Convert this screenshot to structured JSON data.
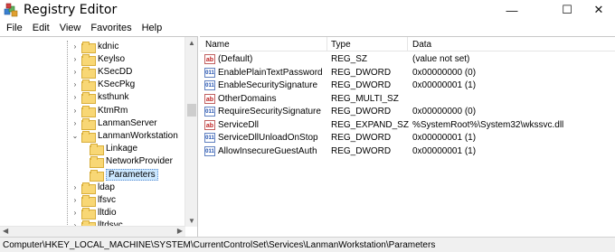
{
  "window": {
    "title": "Registry Editor",
    "minimize_glyph": "—",
    "maximize_glyph": "☐",
    "close_glyph": "✕"
  },
  "menubar": {
    "items": [
      {
        "label": "File"
      },
      {
        "label": "Edit"
      },
      {
        "label": "View"
      },
      {
        "label": "Favorites"
      },
      {
        "label": "Help"
      }
    ]
  },
  "tree": {
    "items": [
      {
        "label": "kdnic",
        "expander": "›",
        "icon": "folder-icon"
      },
      {
        "label": "Keylso",
        "expander": "›",
        "icon": "folder-icon"
      },
      {
        "label": "KSecDD",
        "expander": "›",
        "icon": "folder-icon"
      },
      {
        "label": "KSecPkg",
        "expander": "›",
        "icon": "folder-icon"
      },
      {
        "label": "ksthunk",
        "expander": "›",
        "icon": "folder-icon"
      },
      {
        "label": "KtmRm",
        "expander": "›",
        "icon": "folder-icon"
      },
      {
        "label": "LanmanServer",
        "expander": "›",
        "icon": "folder-icon"
      },
      {
        "label": "LanmanWorkstation",
        "expander": "⌄",
        "icon": "folder-icon"
      },
      {
        "label": "Linkage",
        "expander": "",
        "icon": "folder-icon"
      },
      {
        "label": "NetworkProvider",
        "expander": "",
        "icon": "folder-icon"
      },
      {
        "label": "Parameters",
        "expander": "",
        "icon": "folder-icon",
        "selected": true
      },
      {
        "label": "ldap",
        "expander": "›",
        "icon": "folder-icon"
      },
      {
        "label": "lfsvc",
        "expander": "›",
        "icon": "folder-icon"
      },
      {
        "label": "lltdio",
        "expander": "›",
        "icon": "folder-icon"
      },
      {
        "label": "lltdsvc",
        "expander": "›",
        "icon": "folder-icon"
      }
    ]
  },
  "list": {
    "columns": {
      "name": "Name",
      "type": "Type",
      "data": "Data"
    },
    "rows": [
      {
        "name": "(Default)",
        "type": "REG_SZ",
        "data": "(value not set)",
        "icon": "string-value-icon",
        "icon_glyph": "ab"
      },
      {
        "name": "EnablePlainTextPassword",
        "type": "REG_DWORD",
        "data": "0x00000000 (0)",
        "icon": "binary-value-icon",
        "icon_glyph": "011"
      },
      {
        "name": "EnableSecuritySignature",
        "type": "REG_DWORD",
        "data": "0x00000001 (1)",
        "icon": "binary-value-icon",
        "icon_glyph": "011"
      },
      {
        "name": "OtherDomains",
        "type": "REG_MULTI_SZ",
        "data": "",
        "icon": "string-value-icon",
        "icon_glyph": "ab"
      },
      {
        "name": "RequireSecuritySignature",
        "type": "REG_DWORD",
        "data": "0x00000000 (0)",
        "icon": "binary-value-icon",
        "icon_glyph": "011"
      },
      {
        "name": "ServiceDll",
        "type": "REG_EXPAND_SZ",
        "data": "%SystemRoot%\\System32\\wkssvc.dll",
        "icon": "string-value-icon",
        "icon_glyph": "ab"
      },
      {
        "name": "ServiceDllUnloadOnStop",
        "type": "REG_DWORD",
        "data": "0x00000001 (1)",
        "icon": "binary-value-icon",
        "icon_glyph": "011"
      },
      {
        "name": "AllowInsecureGuestAuth",
        "type": "REG_DWORD",
        "data": "0x00000001 (1)",
        "icon": "binary-value-icon",
        "icon_glyph": "011"
      }
    ]
  },
  "statusbar": {
    "path": "Computer\\HKEY_LOCAL_MACHINE\\SYSTEM\\CurrentControlSet\\Services\\LanmanWorkstation\\Parameters"
  },
  "colors": {
    "folder": "#f8d775",
    "selection": "#cce8ff",
    "string_icon": "#c02020",
    "binary_icon": "#2050b0"
  }
}
